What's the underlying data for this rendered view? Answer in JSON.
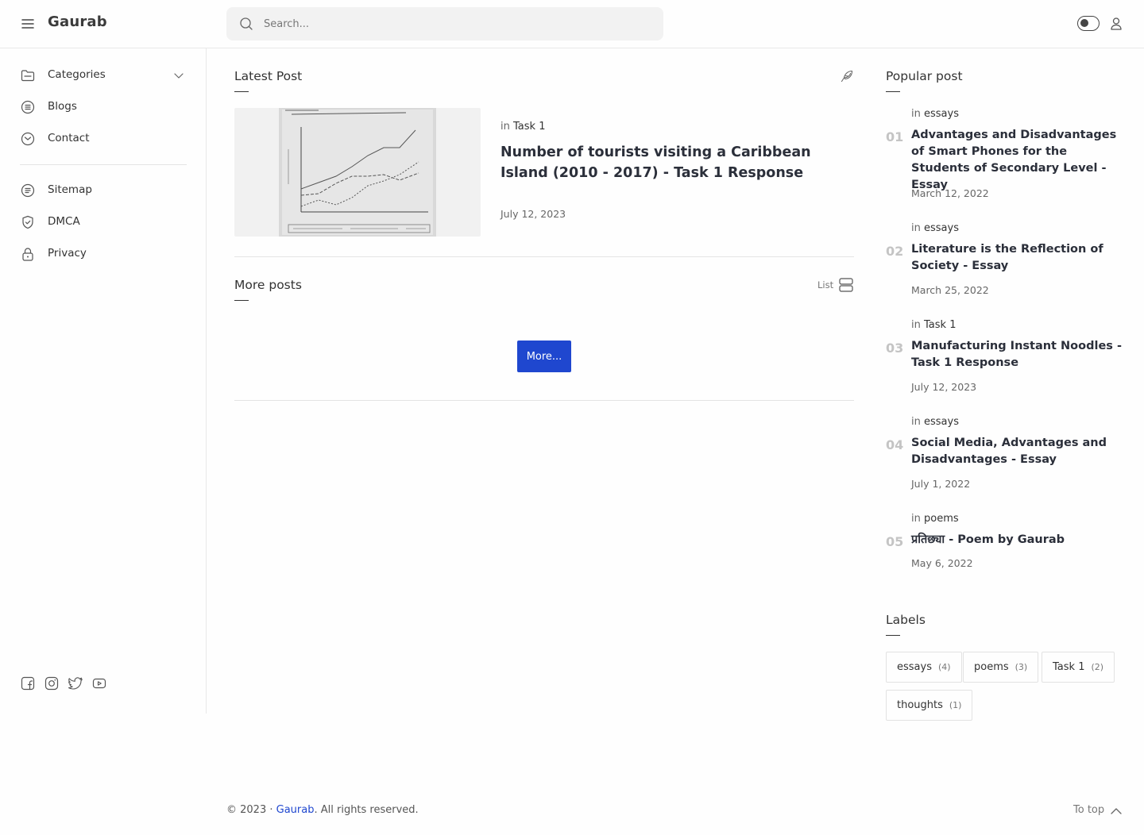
{
  "header": {
    "brand": "Gaurab",
    "search_placeholder": "Search..."
  },
  "sidebar": {
    "items": [
      {
        "label": "Categories",
        "icon": "folder-icon"
      },
      {
        "label": "Blogs",
        "icon": "list-icon"
      },
      {
        "label": "Contact",
        "icon": "mail-icon"
      },
      {
        "label": "Sitemap",
        "icon": "sitemap-icon"
      },
      {
        "label": "DMCA",
        "icon": "shield-icon"
      },
      {
        "label": "Privacy",
        "icon": "lock-icon"
      }
    ],
    "social": [
      "facebook-icon",
      "instagram-icon",
      "twitter-icon",
      "youtube-icon"
    ]
  },
  "main": {
    "latest_title": "Latest Post",
    "latest_post": {
      "in_label": "in",
      "category": "Task 1",
      "title": "Number of tourists visiting a Caribbean Island (2010 - 2017) - Task 1 Response",
      "date": "July 12, 2023"
    },
    "more_title": "More posts",
    "list_label": "List",
    "more_button": "More..."
  },
  "popular": {
    "title": "Popular post",
    "posts": [
      {
        "num": "01",
        "in_label": "in",
        "category": "essays",
        "title": "Advantages and Disadvantages of Smart Phones for the Students of Secondary Level - Essay",
        "date": "March 12, 2022"
      },
      {
        "num": "02",
        "in_label": "in",
        "category": "essays",
        "title": "Literature is the Reflection of Society - Essay",
        "date": "March 25, 2022"
      },
      {
        "num": "03",
        "in_label": "in",
        "category": "Task 1",
        "title": "Manufacturing Instant Noodles - Task 1 Response",
        "date": "July 12, 2023"
      },
      {
        "num": "04",
        "in_label": "in",
        "category": "essays",
        "title": "Social Media, Advantages and Disadvantages - Essay",
        "date": "July 1, 2022"
      },
      {
        "num": "05",
        "in_label": "in",
        "category": "poems",
        "title": "प्रतिछ्या - Poem by Gaurab",
        "date": "May 6, 2022"
      }
    ]
  },
  "labels": {
    "title": "Labels",
    "tags": [
      {
        "name": "essays",
        "count": "(4)"
      },
      {
        "name": "poems",
        "count": "(3)"
      },
      {
        "name": "Task 1",
        "count": "(2)"
      },
      {
        "name": "thoughts",
        "count": "(1)"
      }
    ]
  },
  "footer": {
    "copyright_prefix": "© 2023 ·",
    "site_name": "Gaurab",
    "rights": ". All rights reserved.",
    "to_top": "To top"
  },
  "colors": {
    "accent": "#1f47cf",
    "text": "#2b2f3a",
    "muted": "#666666",
    "border": "#e4e4e4"
  }
}
